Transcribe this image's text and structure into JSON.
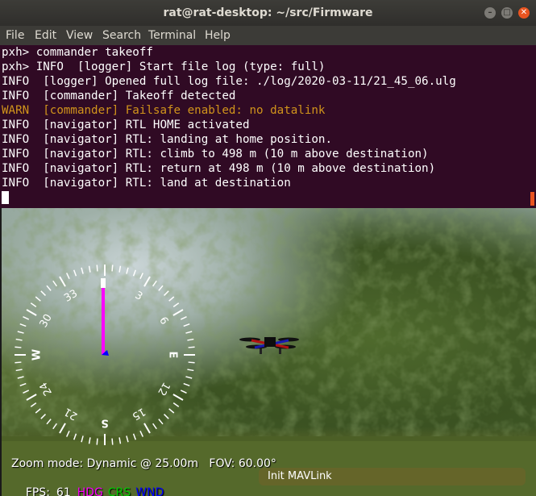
{
  "window": {
    "title": "rat@rat-desktop: ~/src/Firmware",
    "controls": {
      "minimize": "–",
      "maximize": "□",
      "close": "✕"
    }
  },
  "menubar": {
    "items": [
      "File",
      "Edit",
      "View",
      "Search",
      "Terminal",
      "Help"
    ]
  },
  "terminal": {
    "lines": [
      {
        "text": "pxh> commander takeoff",
        "level": "normal"
      },
      {
        "text": "pxh> INFO  [logger] Start file log (type: full)",
        "level": "normal"
      },
      {
        "text": "INFO  [logger] Opened full log file: ./log/2020-03-11/21_45_06.ulg",
        "level": "normal"
      },
      {
        "text": "INFO  [commander] Takeoff detected",
        "level": "normal"
      },
      {
        "text": "WARN  [commander] Failsafe enabled: no datalink",
        "level": "warn"
      },
      {
        "text": "INFO  [navigator] RTL HOME activated",
        "level": "normal"
      },
      {
        "text": "INFO  [navigator] RTL: landing at home position.",
        "level": "normal"
      },
      {
        "text": "INFO  [navigator] RTL: climb to 498 m (10 m above destination)",
        "level": "normal"
      },
      {
        "text": "INFO  [navigator] RTL: return at 498 m (10 m above destination)",
        "level": "normal"
      },
      {
        "text": "INFO  [navigator] RTL: land at destination",
        "level": "normal"
      }
    ],
    "warn_color": "#d1941b",
    "background": "#300a24"
  },
  "hud": {
    "zoom_line": "Zoom mode: Dynamic @ 25.00m   FOV: 60.00°",
    "fps_label": "FPS:",
    "fps_value": "61",
    "hdg_label": "HDG",
    "crs_label": "CRS",
    "wnd_label": "WND",
    "hdg_color": "#ff00ff",
    "crs_color": "#00d000",
    "wnd_color": "#0000ff",
    "status_message": "Init MAVLink"
  },
  "compass": {
    "cardinals": [
      "N",
      "E",
      "S",
      "W"
    ],
    "labels": [
      "3",
      "6",
      "E",
      "12",
      "15",
      "S",
      "21",
      "24",
      "W",
      "30",
      "33"
    ],
    "heading_pointer_color": "#ff00ff"
  },
  "icons": {
    "vehicle": "quadcopter-icon"
  }
}
